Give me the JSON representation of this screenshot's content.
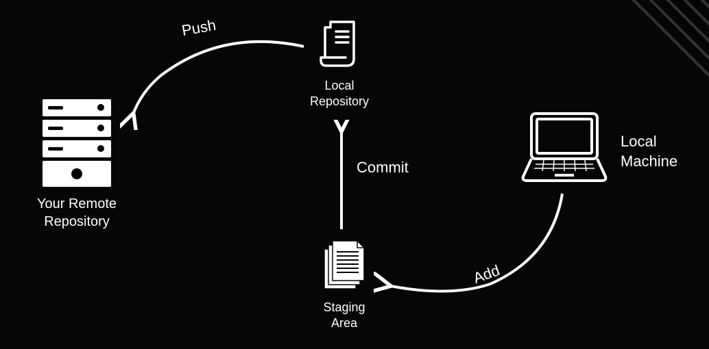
{
  "nodes": {
    "remote": {
      "label": "Your Remote\nRepository"
    },
    "local_repo": {
      "label": "Local\nRepository"
    },
    "staging": {
      "label": "Staging\nArea"
    },
    "machine": {
      "label": "Local\nMachine"
    }
  },
  "arrows": {
    "push": {
      "label": "Push"
    },
    "commit": {
      "label": "Commit"
    },
    "add": {
      "label": "Add"
    }
  },
  "colors": {
    "bg": "#060607",
    "fg": "#ffffff",
    "stroke": "#2a2a2a"
  }
}
